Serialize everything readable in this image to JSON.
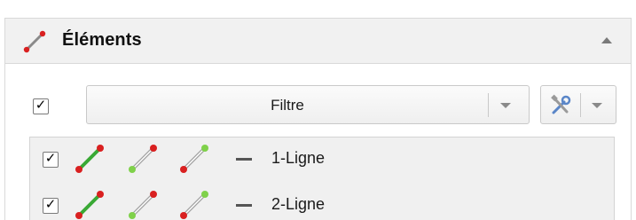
{
  "panel": {
    "title": "Éléments",
    "title_icon": "segment-icon",
    "collapse_icon": "chevron-up-icon"
  },
  "filter": {
    "show_all_checked": true,
    "label": "Filtre",
    "dropdown_icon": "chevron-down-icon",
    "tools_icon": "wrench-screwdriver-icon"
  },
  "elements": [
    {
      "name": "1-Ligne",
      "checked": true,
      "style": "line-icon"
    },
    {
      "name": "2-Ligne",
      "checked": true,
      "style": "line-icon"
    }
  ],
  "colors": {
    "line_green": "#39a935",
    "line_gray": "#9a9a9a",
    "point_red": "#d92020",
    "point_green": "#7fd14a"
  }
}
